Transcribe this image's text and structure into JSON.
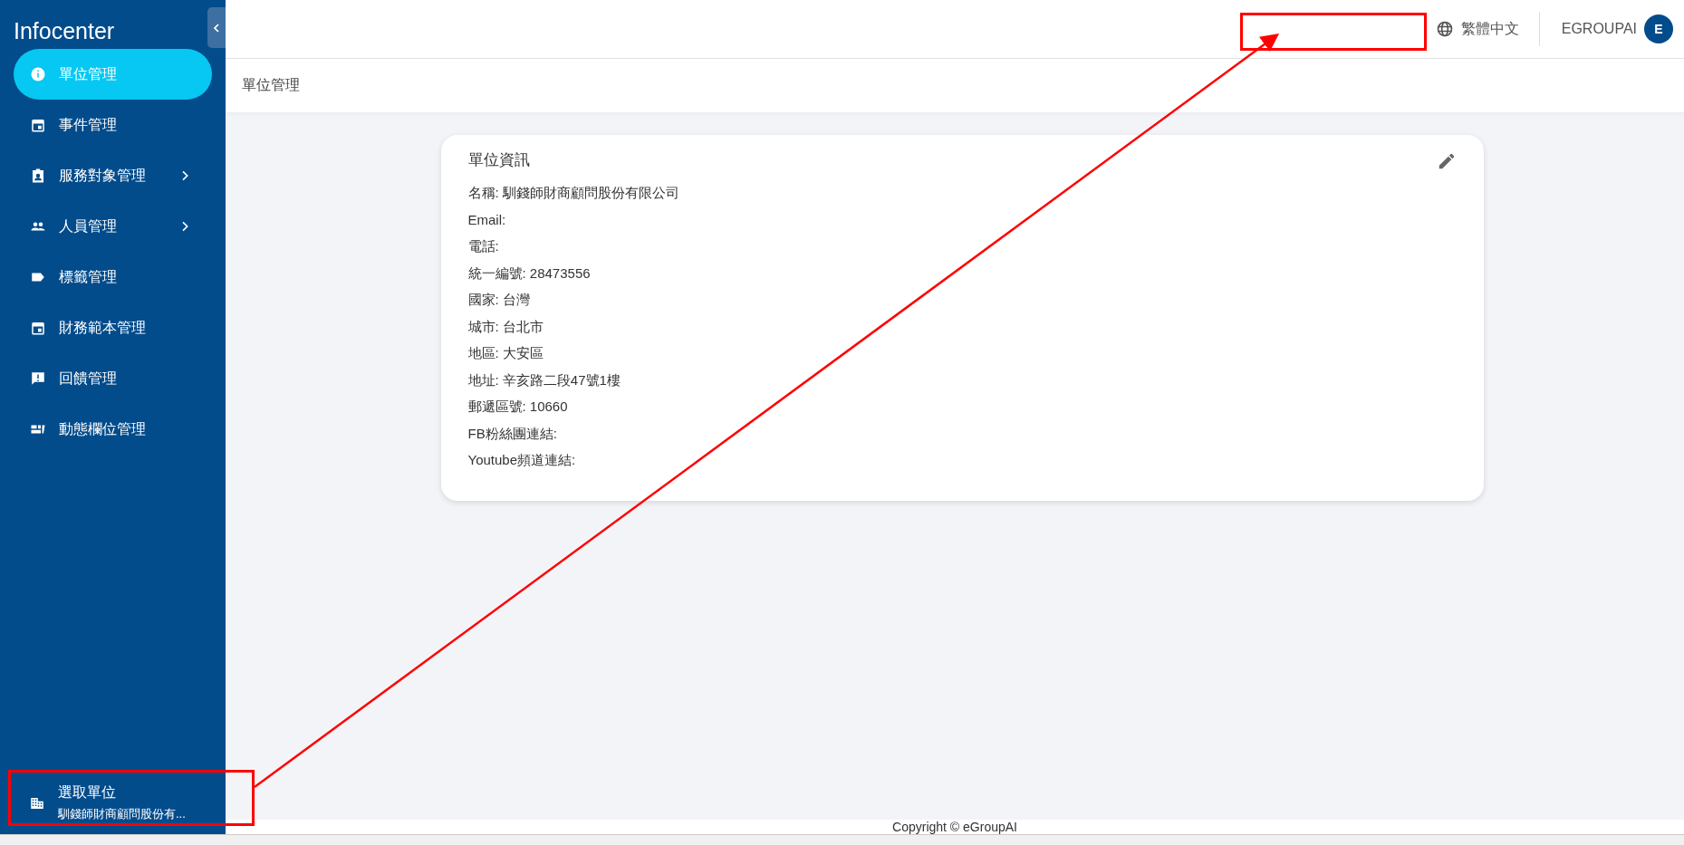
{
  "sidebar": {
    "title": "Infocenter",
    "items": [
      {
        "label": "單位管理",
        "selected": true,
        "expandable": false
      },
      {
        "label": "事件管理",
        "selected": false,
        "expandable": false
      },
      {
        "label": "服務對象管理",
        "selected": false,
        "expandable": true
      },
      {
        "label": "人員管理",
        "selected": false,
        "expandable": true
      },
      {
        "label": "標籤管理",
        "selected": false,
        "expandable": false
      },
      {
        "label": "財務範本管理",
        "selected": false,
        "expandable": false
      },
      {
        "label": "回饋管理",
        "selected": false,
        "expandable": false
      },
      {
        "label": "動態欄位管理",
        "selected": false,
        "expandable": false
      }
    ],
    "unit_picker": {
      "label": "選取單位",
      "value": "馴錢師財商顧問股份有..."
    }
  },
  "header": {
    "language": "繁體中文",
    "user": "EGROUPAI",
    "avatar": "E"
  },
  "breadcrumb": "單位管理",
  "card": {
    "title": "單位資訊",
    "fields": [
      {
        "label": "名稱:",
        "value": "馴錢師財商顧問股份有限公司"
      },
      {
        "label": "Email:"
      },
      {
        "label": "電話:"
      },
      {
        "label": "統一編號:",
        "value": "28473556"
      },
      {
        "label": "國家:",
        "value": "台灣"
      },
      {
        "label": "城市:",
        "value": "台北市"
      },
      {
        "label": "地區:",
        "value": "大安區"
      },
      {
        "label": "地址:",
        "value": "辛亥路二段47號1樓"
      },
      {
        "label": "郵遞區號:",
        "value": "10660"
      },
      {
        "label": "FB粉絲團連結:"
      },
      {
        "label": "Youtube頻道連結:"
      }
    ]
  },
  "footer": "Copyright © eGroupAI"
}
